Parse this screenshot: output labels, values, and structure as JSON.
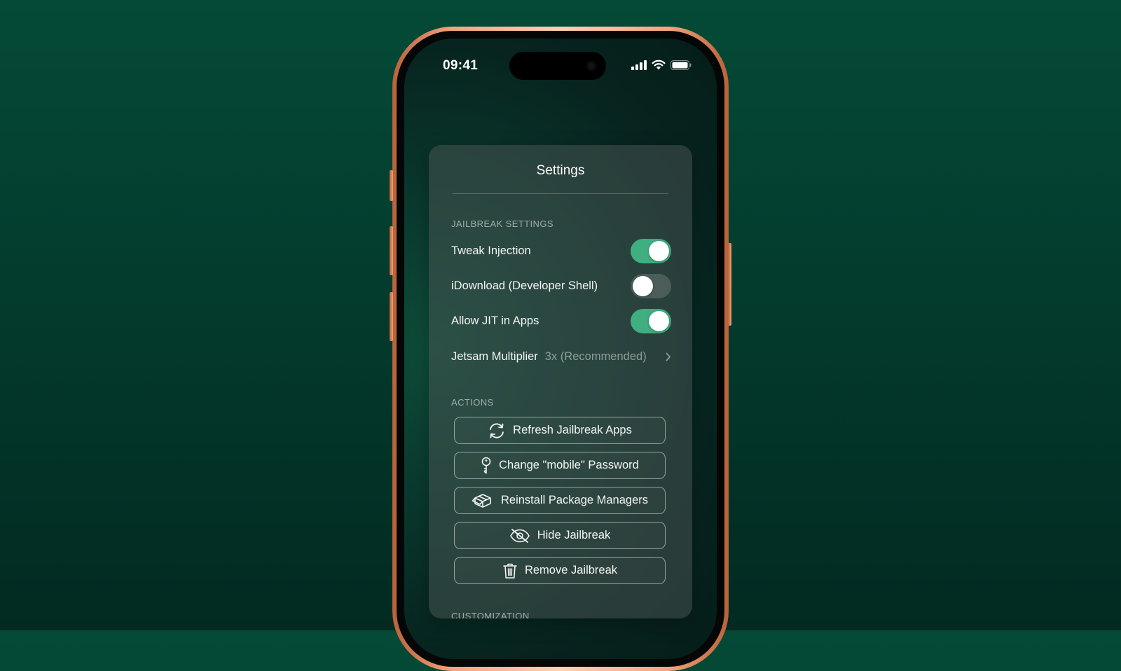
{
  "status_bar": {
    "time": "09:41"
  },
  "panel": {
    "title": "Settings"
  },
  "jailbreak_settings": {
    "header": "JAILBREAK SETTINGS",
    "toggles": [
      {
        "label": "Tweak Injection",
        "on": true
      },
      {
        "label": "iDownload (Developer Shell)",
        "on": false
      },
      {
        "label": "Allow JIT in Apps",
        "on": true
      }
    ],
    "jetsam": {
      "label": "Jetsam Multiplier",
      "value": "3x (Recommended)"
    }
  },
  "actions": {
    "header": "ACTIONS",
    "buttons": [
      {
        "label": "Refresh Jailbreak Apps",
        "icon": "refresh-icon"
      },
      {
        "label": "Change \"mobile\" Password",
        "icon": "key-icon"
      },
      {
        "label": "Reinstall Package Managers",
        "icon": "package-icon"
      },
      {
        "label": "Hide Jailbreak",
        "icon": "eye-slash-icon"
      },
      {
        "label": "Remove Jailbreak",
        "icon": "trash-icon"
      }
    ]
  },
  "customization": {
    "header": "CUSTOMIZATION"
  },
  "colors": {
    "background": "#033a2c",
    "toggle_on": "#3fae80",
    "phone_frame": "#f4a57c"
  }
}
